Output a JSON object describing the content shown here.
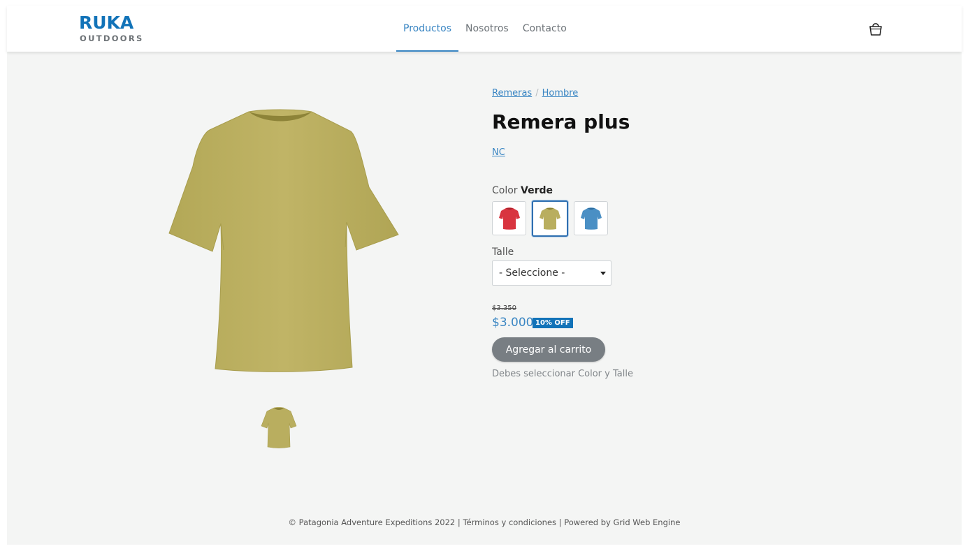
{
  "logo": {
    "line1": "RUKA",
    "line2": "OUTDOORS"
  },
  "nav": {
    "items": [
      "Productos",
      "Nosotros",
      "Contacto"
    ],
    "active": "Productos"
  },
  "breadcrumb": {
    "items": [
      "Remeras",
      "Hombre"
    ],
    "separator": "/"
  },
  "product": {
    "title": "Remera plus",
    "brand": "NC",
    "color_label": "Color",
    "selected_color": "Verde",
    "swatches": [
      {
        "color_name": "red",
        "hex": "#d8343f"
      },
      {
        "color_name": "olive",
        "hex": "#b9ae5f"
      },
      {
        "color_name": "blue",
        "hex": "#4a8fc4"
      }
    ],
    "size_label": "Talle",
    "size_selected": "- Seleccione -",
    "old_price": "$3.350",
    "price": "$3.000",
    "discount": "10% OFF",
    "add_to_cart": "Agregar al carrito",
    "helper": "Debes seleccionar Color y Talle"
  },
  "footer": {
    "copyright": "© Patagonia Adventure Expeditions 2022",
    "terms": "Términos y condiciones",
    "powered": "Powered by Grid Web Engine",
    "separator": "|"
  },
  "colors": {
    "accent": "#3a86c3",
    "brand": "#1273b8",
    "shirt": "#b9ae5f",
    "button": "#787e83"
  }
}
